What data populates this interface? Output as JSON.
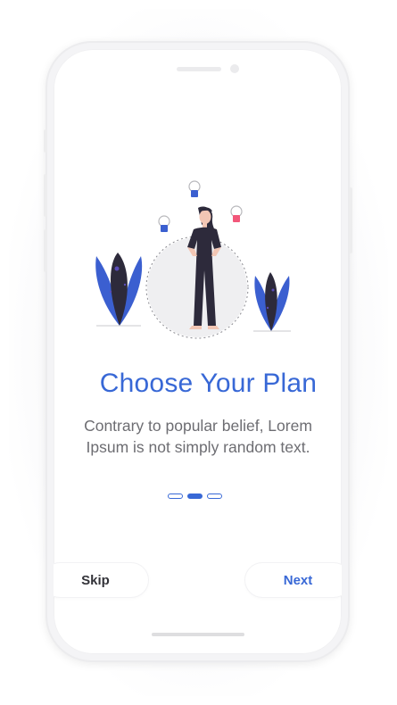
{
  "onboarding": {
    "title": "Choose Your Plan",
    "description": "Contrary to popular belief, Lorem Ipsum is not simply random text.",
    "page_indicator": {
      "total": 3,
      "current": 2
    },
    "skip_label": "Skip",
    "next_label": "Next"
  },
  "colors": {
    "accent": "#3868d6",
    "leaf_blue": "#3b5fd0",
    "figure_dark": "#2d2a3b",
    "pink_accent": "#f2577a",
    "text_gray": "#6d6d72"
  },
  "icons": [
    "speaker-grille",
    "front-camera",
    "ornament-blue",
    "ornament-pink",
    "plant-leaves",
    "person-figure"
  ]
}
